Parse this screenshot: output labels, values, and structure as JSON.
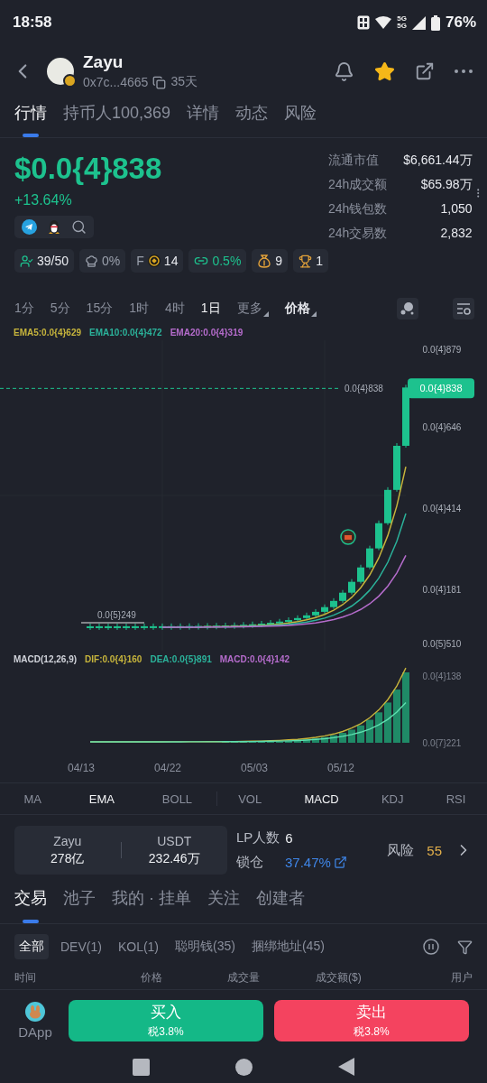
{
  "status_bar": {
    "time": "18:58",
    "network_labels": [
      "5G",
      "5G"
    ],
    "battery": "76%"
  },
  "token": {
    "name": "Zayu",
    "address": "0x7c...4665",
    "age": "35天",
    "favorited": true
  },
  "tabs": [
    {
      "label": "行情",
      "selected": true
    },
    {
      "label": "持币人100,369",
      "selected": false
    },
    {
      "label": "详情",
      "selected": false
    },
    {
      "label": "动态",
      "selected": false
    },
    {
      "label": "风险",
      "selected": false
    }
  ],
  "price": {
    "value": "$0.0{4}838",
    "change": "+13.64%"
  },
  "social_links": [
    {
      "kind": "telegram"
    },
    {
      "kind": "qq"
    },
    {
      "kind": "search"
    }
  ],
  "stats": [
    {
      "label": "流通市值",
      "value": "$6,661.44万"
    },
    {
      "label": "24h成交额",
      "value": "$65.98万"
    },
    {
      "label": "24h钱包数",
      "value": "1,050"
    },
    {
      "label": "24h交易数",
      "value": "2,832"
    }
  ],
  "badges": [
    {
      "kind": "holders",
      "text": "39/50"
    },
    {
      "kind": "chef",
      "text": "0%"
    },
    {
      "kind": "fee",
      "prefix": "F",
      "text": "14"
    },
    {
      "kind": "bond",
      "text": "0.5%"
    },
    {
      "kind": "bag",
      "text": "9"
    },
    {
      "kind": "trophy",
      "text": "1"
    }
  ],
  "intervals": [
    {
      "label": "1分",
      "selected": false,
      "dropdown": false
    },
    {
      "label": "5分",
      "selected": false,
      "dropdown": false
    },
    {
      "label": "15分",
      "selected": false,
      "dropdown": false
    },
    {
      "label": "1时",
      "selected": false,
      "dropdown": false
    },
    {
      "label": "4时",
      "selected": false,
      "dropdown": false
    },
    {
      "label": "1日",
      "selected": true,
      "dropdown": false
    },
    {
      "label": "更多",
      "selected": false,
      "dropdown": true
    }
  ],
  "chart_mode": {
    "label": "价格"
  },
  "ema_legend": [
    {
      "label": "EMA5:0.0{4}629",
      "color": "#c6b43c"
    },
    {
      "label": "EMA10:0.0{4}472",
      "color": "#2bb29a"
    },
    {
      "label": "EMA20:0.0{4}319",
      "color": "#b56ccc"
    }
  ],
  "price_chart": {
    "axis_labels": [
      "0.0{4}879",
      "0.0{4}646",
      "0.0{4}414",
      "0.0{4}181",
      "0.0{5}510"
    ],
    "last_price_line": "0.0{4}838",
    "last_price_tag": "0.0{4}838",
    "low_marker": "0.0{5}249"
  },
  "macd_legend": [
    {
      "label": "MACD(12,26,9)",
      "color": "#d0d3da"
    },
    {
      "label": "DIF:0.0{4}160",
      "color": "#c6b43c"
    },
    {
      "label": "DEA:0.0{5}891",
      "color": "#2bb29a"
    },
    {
      "label": "MACD:0.0{4}142",
      "color": "#b56ccc"
    }
  ],
  "macd_chart": {
    "axis_labels": [
      "0.0{4}138",
      "0.0{7}221"
    ]
  },
  "date_axis": [
    "04/13",
    "04/22",
    "05/03",
    "05/12"
  ],
  "main_indicators": [
    {
      "label": "MA",
      "selected": false
    },
    {
      "label": "EMA",
      "selected": true
    },
    {
      "label": "BOLL",
      "selected": false
    }
  ],
  "sub_indicators": [
    {
      "label": "VOL",
      "selected": false
    },
    {
      "label": "MACD",
      "selected": true
    },
    {
      "label": "KDJ",
      "selected": false
    },
    {
      "label": "RSI",
      "selected": false
    }
  ],
  "pool": {
    "base_symbol": "Zayu",
    "base_amount": "278亿",
    "quote_symbol": "USDT",
    "quote_amount": "232.46万",
    "lp_label": "LP人数",
    "lp_count": "6",
    "lock_label": "锁仓",
    "lock_value": "37.47%",
    "risk_label": "风险",
    "risk_score": "55"
  },
  "trade_tabs": [
    {
      "label": "交易",
      "selected": true
    },
    {
      "label": "池子",
      "selected": false
    },
    {
      "label": "我的 · 挂单",
      "selected": false
    },
    {
      "label": "关注",
      "selected": false
    },
    {
      "label": "创建者",
      "selected": false
    }
  ],
  "filters": [
    {
      "label": "全部",
      "selected": true
    },
    {
      "label": "DEV(1)",
      "selected": false
    },
    {
      "label": "KOL(1)",
      "selected": false
    },
    {
      "label": "聪明钱(35)",
      "selected": false
    },
    {
      "label": "捆绑地址(45)",
      "selected": false
    }
  ],
  "table_columns": [
    "时间",
    "价格",
    "成交量",
    "成交额($)",
    "用户"
  ],
  "dapp": {
    "label": "DApp"
  },
  "actions": [
    {
      "kind": "buy",
      "label": "买入",
      "tax": "税3.8%"
    },
    {
      "kind": "sell",
      "label": "卖出",
      "tax": "税3.8%"
    }
  ]
}
